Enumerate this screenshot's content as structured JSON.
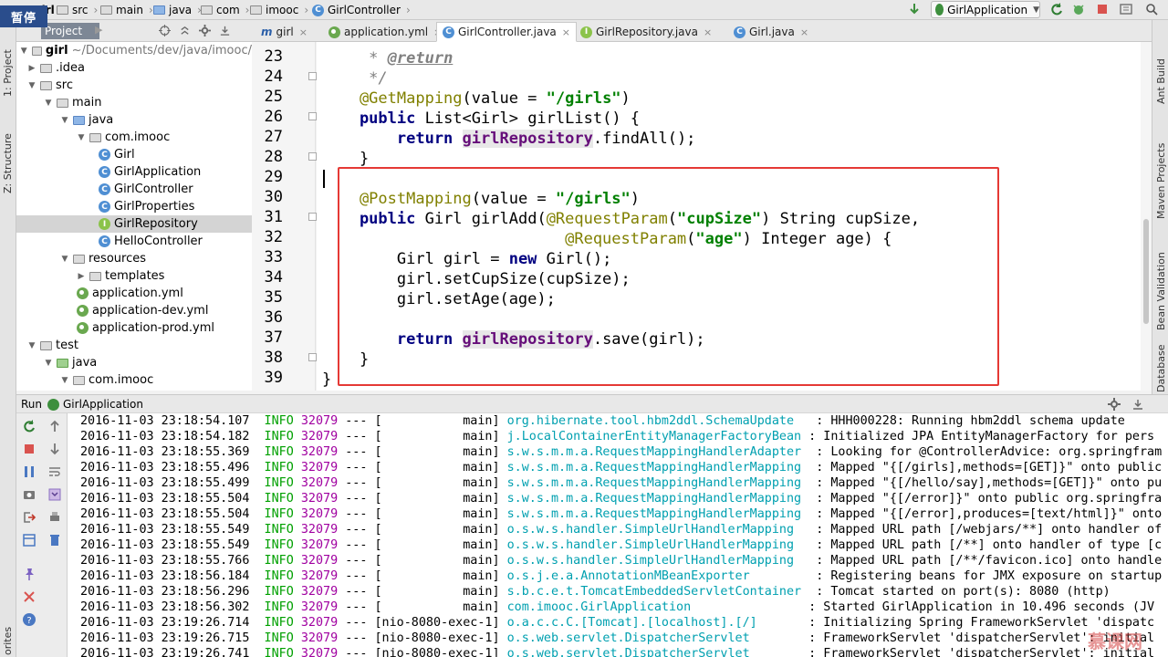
{
  "overlay": {
    "pause": "暂停"
  },
  "breadcrumbs": [
    "girl",
    "src",
    "main",
    "java",
    "com",
    "imooc",
    "GirlController"
  ],
  "toolbar": {
    "run_config": "GirlApplication"
  },
  "left_stripe": {
    "project": "1: Project",
    "structure": "Z: Structure",
    "favorites": "orites"
  },
  "right_stripe": [
    "Ant Build",
    "Maven Projects",
    "Bean Validation",
    "Database"
  ],
  "project_panel": {
    "tab": "Project"
  },
  "tree": [
    {
      "label": "girl",
      "suffix": "~/Documents/dev/java/imooc/",
      "type": "folder",
      "arrow": "▼",
      "bold": true
    },
    {
      "label": ".idea",
      "type": "folder",
      "arrow": "▶"
    },
    {
      "label": "src",
      "type": "folder",
      "arrow": "▼"
    },
    {
      "label": "main",
      "type": "folder",
      "arrow": "▼"
    },
    {
      "label": "java",
      "type": "folder-blue",
      "arrow": "▼"
    },
    {
      "label": "com.imooc",
      "type": "folder",
      "arrow": "▼"
    },
    {
      "label": "Girl",
      "type": "class"
    },
    {
      "label": "GirlApplication",
      "type": "class"
    },
    {
      "label": "GirlController",
      "type": "class"
    },
    {
      "label": "GirlProperties",
      "type": "class"
    },
    {
      "label": "GirlRepository",
      "type": "interface",
      "selected": true
    },
    {
      "label": "HelloController",
      "type": "class"
    },
    {
      "label": "resources",
      "type": "folder",
      "arrow": "▼"
    },
    {
      "label": "templates",
      "type": "folder",
      "arrow": "▶"
    },
    {
      "label": "application.yml",
      "type": "yml"
    },
    {
      "label": "application-dev.yml",
      "type": "yml"
    },
    {
      "label": "application-prod.yml",
      "type": "yml"
    },
    {
      "label": "test",
      "type": "folder",
      "arrow": "▼"
    },
    {
      "label": "java",
      "type": "folder-green",
      "arrow": "▼"
    },
    {
      "label": "com.imooc",
      "type": "folder",
      "arrow": "▼"
    }
  ],
  "editor_tabs": [
    {
      "label": "girl",
      "icon": "m"
    },
    {
      "label": "application.yml",
      "icon": "yml"
    },
    {
      "label": "GirlController.java",
      "icon": "class",
      "active": true
    },
    {
      "label": "GirlRepository.java",
      "icon": "interface"
    },
    {
      "label": "Girl.java",
      "icon": "class"
    }
  ],
  "code": {
    "line_numbers": [
      "23",
      "24",
      "25",
      "26",
      "27",
      "28",
      "29",
      "30",
      "31",
      "32",
      "33",
      "34",
      "35",
      "36",
      "37",
      "38",
      "39"
    ],
    "lines": [
      [
        {
          "t": "     * ",
          "c": "cmt"
        },
        {
          "t": "@return",
          "c": "doctag"
        }
      ],
      [
        {
          "t": "     */",
          "c": "cmt"
        }
      ],
      [
        {
          "t": "    @GetMapping",
          "c": "an"
        },
        {
          "t": "(value = ",
          "c": ""
        },
        {
          "t": "\"/girls\"",
          "c": "str"
        },
        {
          "t": ")",
          "c": ""
        }
      ],
      [
        {
          "t": "    public ",
          "c": "kw"
        },
        {
          "t": "List<Girl> ",
          "c": ""
        },
        {
          "t": "girlList",
          "c": "prm"
        },
        {
          "t": "() {",
          "c": ""
        }
      ],
      [
        {
          "t": "        return ",
          "c": "kw"
        },
        {
          "t": "girlRepository",
          "c": "fld"
        },
        {
          "t": ".findAll();",
          "c": ""
        }
      ],
      [
        {
          "t": "    }",
          "c": ""
        }
      ],
      [
        {
          "t": "",
          "c": ""
        }
      ],
      [
        {
          "t": "    @PostMapping",
          "c": "an"
        },
        {
          "t": "(value = ",
          "c": ""
        },
        {
          "t": "\"/girls\"",
          "c": "str"
        },
        {
          "t": ")",
          "c": ""
        }
      ],
      [
        {
          "t": "    public ",
          "c": "kw"
        },
        {
          "t": "Girl ",
          "c": ""
        },
        {
          "t": "girlAdd",
          "c": "prm"
        },
        {
          "t": "(",
          "c": ""
        },
        {
          "t": "@RequestParam",
          "c": "an"
        },
        {
          "t": "(",
          "c": ""
        },
        {
          "t": "\"cupSize\"",
          "c": "str"
        },
        {
          "t": ") String cupSize,",
          "c": ""
        }
      ],
      [
        {
          "t": "                          ",
          "c": ""
        },
        {
          "t": "@RequestParam",
          "c": "an"
        },
        {
          "t": "(",
          "c": ""
        },
        {
          "t": "\"age\"",
          "c": "str"
        },
        {
          "t": ") Integer age) {",
          "c": ""
        }
      ],
      [
        {
          "t": "        Girl girl = ",
          "c": ""
        },
        {
          "t": "new ",
          "c": "kw"
        },
        {
          "t": "Girl();",
          "c": ""
        }
      ],
      [
        {
          "t": "        girl.setCupSize(cupSize);",
          "c": ""
        }
      ],
      [
        {
          "t": "        girl.setAge(age);",
          "c": ""
        }
      ],
      [
        {
          "t": "",
          "c": ""
        }
      ],
      [
        {
          "t": "        return ",
          "c": "kw"
        },
        {
          "t": "girlRepository",
          "c": "fld"
        },
        {
          "t": ".save(girl);",
          "c": ""
        }
      ],
      [
        {
          "t": "    }",
          "c": ""
        }
      ],
      [
        {
          "t": "}",
          "c": ""
        }
      ]
    ]
  },
  "run_panel": {
    "title": "Run",
    "config": "GirlApplication"
  },
  "console": [
    {
      "ts": "2016-11-03 23:18:54.107",
      "lvl": "INFO",
      "pid": "32079",
      "thr": " --- [           main]",
      "lgr": "org.hibernate.tool.hbm2ddl.SchemaUpdate  ",
      "msg": " : HHH000228: Running hbm2ddl schema update"
    },
    {
      "ts": "2016-11-03 23:18:54.182",
      "lvl": "INFO",
      "pid": "32079",
      "thr": " --- [           main]",
      "lgr": "j.LocalContainerEntityManagerFactoryBean",
      "msg": " : Initialized JPA EntityManagerFactory for pers"
    },
    {
      "ts": "2016-11-03 23:18:55.369",
      "lvl": "INFO",
      "pid": "32079",
      "thr": " --- [           main]",
      "lgr": "s.w.s.m.m.a.RequestMappingHandlerAdapter ",
      "msg": " : Looking for @ControllerAdvice: org.springfram"
    },
    {
      "ts": "2016-11-03 23:18:55.496",
      "lvl": "INFO",
      "pid": "32079",
      "thr": " --- [           main]",
      "lgr": "s.w.s.m.m.a.RequestMappingHandlerMapping ",
      "msg": " : Mapped \"{[/girls],methods=[GET]}\" onto public"
    },
    {
      "ts": "2016-11-03 23:18:55.499",
      "lvl": "INFO",
      "pid": "32079",
      "thr": " --- [           main]",
      "lgr": "s.w.s.m.m.a.RequestMappingHandlerMapping ",
      "msg": " : Mapped \"{[/hello/say],methods=[GET]}\" onto pu"
    },
    {
      "ts": "2016-11-03 23:18:55.504",
      "lvl": "INFO",
      "pid": "32079",
      "thr": " --- [           main]",
      "lgr": "s.w.s.m.m.a.RequestMappingHandlerMapping ",
      "msg": " : Mapped \"{[/error]}\" onto public org.springfra"
    },
    {
      "ts": "2016-11-03 23:18:55.504",
      "lvl": "INFO",
      "pid": "32079",
      "thr": " --- [           main]",
      "lgr": "s.w.s.m.m.a.RequestMappingHandlerMapping ",
      "msg": " : Mapped \"{[/error],produces=[text/html]}\" onto"
    },
    {
      "ts": "2016-11-03 23:18:55.549",
      "lvl": "INFO",
      "pid": "32079",
      "thr": " --- [           main]",
      "lgr": "o.s.w.s.handler.SimpleUrlHandlerMapping  ",
      "msg": " : Mapped URL path [/webjars/**] onto handler of"
    },
    {
      "ts": "2016-11-03 23:18:55.549",
      "lvl": "INFO",
      "pid": "32079",
      "thr": " --- [           main]",
      "lgr": "o.s.w.s.handler.SimpleUrlHandlerMapping  ",
      "msg": " : Mapped URL path [/**] onto handler of type [c"
    },
    {
      "ts": "2016-11-03 23:18:55.766",
      "lvl": "INFO",
      "pid": "32079",
      "thr": " --- [           main]",
      "lgr": "o.s.w.s.handler.SimpleUrlHandlerMapping  ",
      "msg": " : Mapped URL path [/**/favicon.ico] onto handle"
    },
    {
      "ts": "2016-11-03 23:18:56.184",
      "lvl": "INFO",
      "pid": "32079",
      "thr": " --- [           main]",
      "lgr": "o.s.j.e.a.AnnotationMBeanExporter        ",
      "msg": " : Registering beans for JMX exposure on startup"
    },
    {
      "ts": "2016-11-03 23:18:56.296",
      "lvl": "INFO",
      "pid": "32079",
      "thr": " --- [           main]",
      "lgr": "s.b.c.e.t.TomcatEmbeddedServletContainer ",
      "msg": " : Tomcat started on port(s): 8080 (http)"
    },
    {
      "ts": "2016-11-03 23:18:56.302",
      "lvl": "INFO",
      "pid": "32079",
      "thr": " --- [           main]",
      "lgr": "com.imooc.GirlApplication               ",
      "msg": " : Started GirlApplication in 10.496 seconds (JV"
    },
    {
      "ts": "2016-11-03 23:19:26.714",
      "lvl": "INFO",
      "pid": "32079",
      "thr": " --- [nio-8080-exec-1]",
      "lgr": "o.a.c.c.C.[Tomcat].[localhost].[/]      ",
      "msg": " : Initializing Spring FrameworkServlet 'dispatc"
    },
    {
      "ts": "2016-11-03 23:19:26.715",
      "lvl": "INFO",
      "pid": "32079",
      "thr": " --- [nio-8080-exec-1]",
      "lgr": "o.s.web.servlet.DispatcherServlet       ",
      "msg": " : FrameworkServlet 'dispatcherServlet': initial"
    },
    {
      "ts": "2016-11-03 23:19:26.741",
      "lvl": "INFO",
      "pid": "32079",
      "thr": " --- [nio-8080-exec-1]",
      "lgr": "o.s.web.servlet.DispatcherServlet       ",
      "msg": " : FrameworkServlet 'dispatcherServlet': initial"
    }
  ],
  "watermark": "慕课网",
  "colors": {
    "highlight_box": "#e53935",
    "annotation": "#808000",
    "keyword": "#000080",
    "string": "#008000",
    "field": "#660e7a",
    "log_info": "#00a000",
    "log_pid": "#a000a0",
    "logger": "#00a0b0"
  }
}
